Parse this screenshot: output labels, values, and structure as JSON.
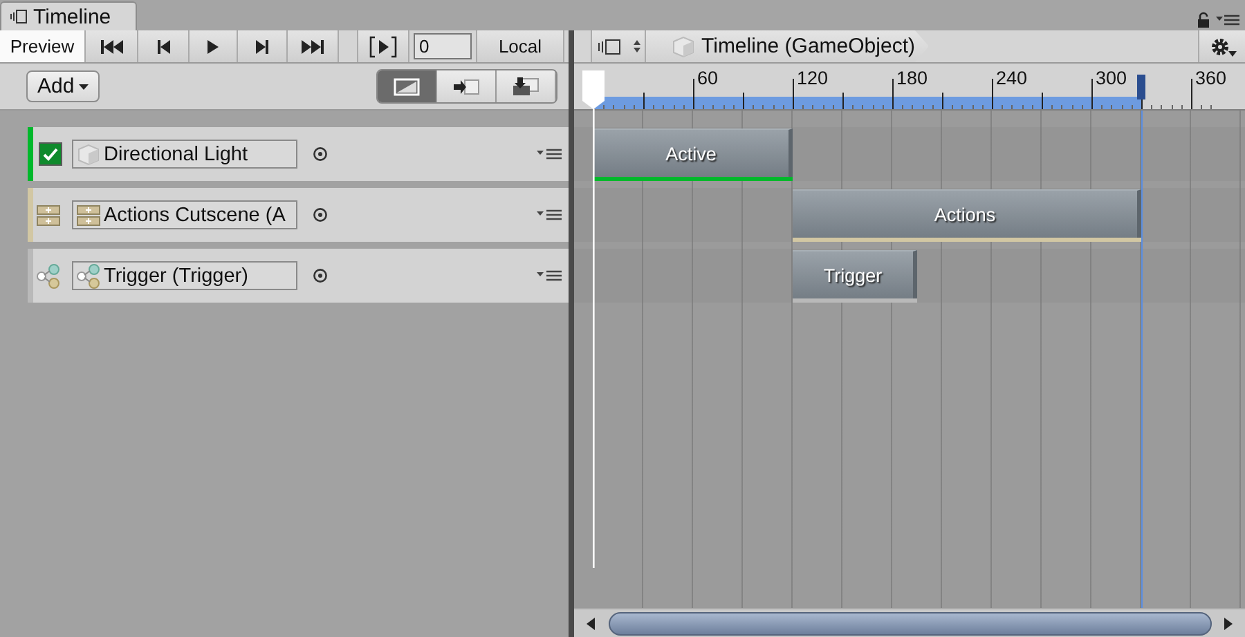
{
  "window": {
    "title": "Timeline"
  },
  "toolbar": {
    "preview": {
      "label": "Preview",
      "selected": true
    },
    "frame": {
      "value": "0"
    },
    "space": {
      "label": "Local"
    }
  },
  "add_button": {
    "label": "Add"
  },
  "view_toggle": [
    {
      "kind": "curves",
      "selected": true
    },
    {
      "kind": "markers",
      "selected": false
    },
    {
      "kind": "snap",
      "selected": false
    }
  ],
  "breadcrumb": {
    "label": "Timeline (GameObject)"
  },
  "ruler": {
    "ticks": [
      "60",
      "120",
      "180",
      "240",
      "300",
      "360"
    ]
  },
  "tracks": [
    {
      "name": "Directional Light",
      "kind": "activation",
      "color": "#00b82c",
      "checked": true,
      "clips": [
        {
          "label": "Active"
        }
      ]
    },
    {
      "name": "Actions Cutscene (A",
      "kind": "playable",
      "color": "#d2c7a3",
      "clips": [
        {
          "label": "Actions"
        }
      ]
    },
    {
      "name": "Trigger (Trigger)",
      "kind": "trigger",
      "color": "#b9b9b9",
      "clips": [
        {
          "label": "Trigger"
        }
      ]
    }
  ]
}
